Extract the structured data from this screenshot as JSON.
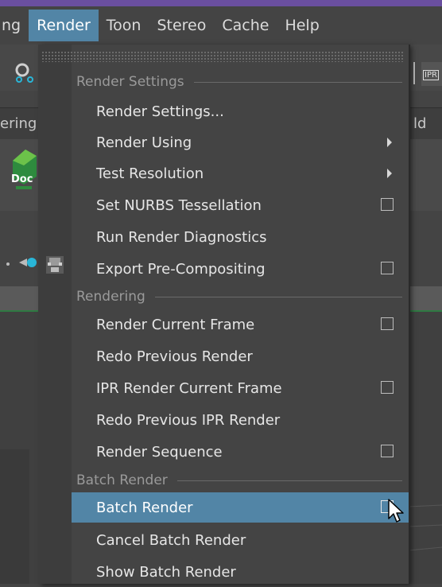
{
  "menubar": {
    "items": [
      "ng",
      "Render",
      "Toon",
      "Stereo",
      "Cache",
      "Help"
    ],
    "active_index": 1
  },
  "background": {
    "tab_left": "ering",
    "tab_right": "ld",
    "shelf_icon_label": "Doc",
    "ipr_label": "IPR"
  },
  "menu": {
    "sections": [
      "Render Settings",
      "Rendering",
      "Batch Render"
    ],
    "items": [
      {
        "label": "Render Settings...",
        "control": "none"
      },
      {
        "label": "Render Using",
        "control": "submenu"
      },
      {
        "label": "Test Resolution",
        "control": "submenu"
      },
      {
        "label": "Set NURBS Tessellation",
        "control": "option-box"
      },
      {
        "label": "Run Render Diagnostics",
        "control": "none"
      },
      {
        "label": "Export Pre-Compositing",
        "control": "option-box"
      },
      {
        "label": "Render Current Frame",
        "control": "option-box"
      },
      {
        "label": "Redo Previous Render",
        "control": "none"
      },
      {
        "label": "IPR Render Current Frame",
        "control": "option-box"
      },
      {
        "label": "Redo Previous IPR Render",
        "control": "none"
      },
      {
        "label": "Render Sequence",
        "control": "option-box"
      },
      {
        "label": "Batch Render",
        "control": "option-box",
        "highlighted": true
      },
      {
        "label": "Cancel Batch Render",
        "control": "none"
      },
      {
        "label": "Show Batch Render",
        "control": "none"
      }
    ]
  },
  "colors": {
    "accent": "#5285a6",
    "menu_bg": "#444444",
    "top_strip": "#6a4fa0"
  }
}
